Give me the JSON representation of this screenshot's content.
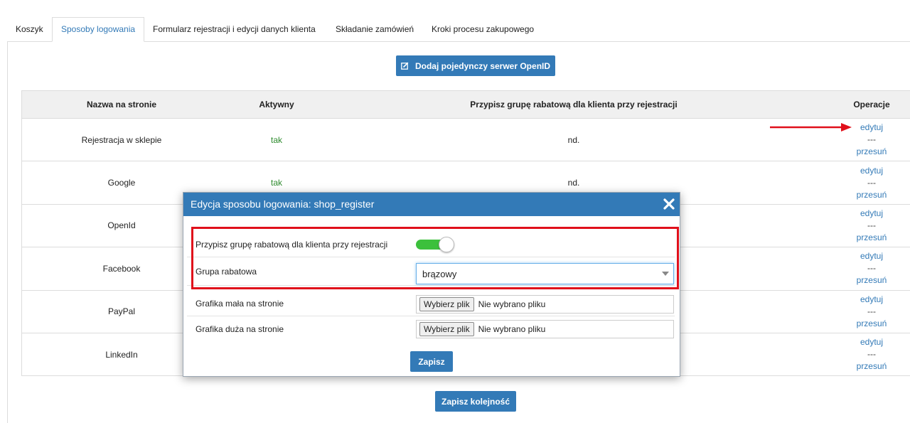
{
  "tabs": [
    "Koszyk",
    "Sposoby logowania",
    "Formularz rejestracji i edycji danych klienta",
    "Składanie zamówień",
    "Kroki procesu zakupowego"
  ],
  "active_tab": "Sposoby logowania",
  "add_openid_button": "Dodaj pojedynczy serwer OpenID",
  "table": {
    "headers": {
      "name": "Nazwa na stronie",
      "active": "Aktywny",
      "discount": "Przypisz grupę rabatową dla klienta przy rejestracji",
      "ops": "Operacje"
    },
    "rows": [
      {
        "name": "Rejestracja w sklepie",
        "active": "tak",
        "discount": "nd."
      },
      {
        "name": "Google",
        "active": "tak",
        "discount": "nd."
      },
      {
        "name": "OpenId",
        "active": "",
        "discount": ""
      },
      {
        "name": "Facebook",
        "active": "",
        "discount": ""
      },
      {
        "name": "PayPal",
        "active": "",
        "discount": ""
      },
      {
        "name": "LinkedIn",
        "active": "",
        "discount": ""
      }
    ],
    "op_edit": "edytuj",
    "op_sep": "---",
    "op_move": "przesuń"
  },
  "save_order_button": "Zapisz kolejność",
  "modal": {
    "title": "Edycja sposobu logowania: shop_register",
    "discount_label": "Przypisz grupę rabatową dla klienta przy rejestracji",
    "discount_enabled": true,
    "group_label": "Grupa rabatowa",
    "group_value": "brązowy",
    "small_image_label": "Grafika mała na stronie",
    "large_image_label": "Grafika duża na stronie",
    "file_button": "Wybierz plik",
    "file_none": "Nie wybrano pliku",
    "save_button": "Zapisz"
  },
  "colors": {
    "primary": "#337ab7",
    "toggle_on": "#3cc03c",
    "highlight": "#e0101b",
    "active_green": "#2e8b2e"
  }
}
